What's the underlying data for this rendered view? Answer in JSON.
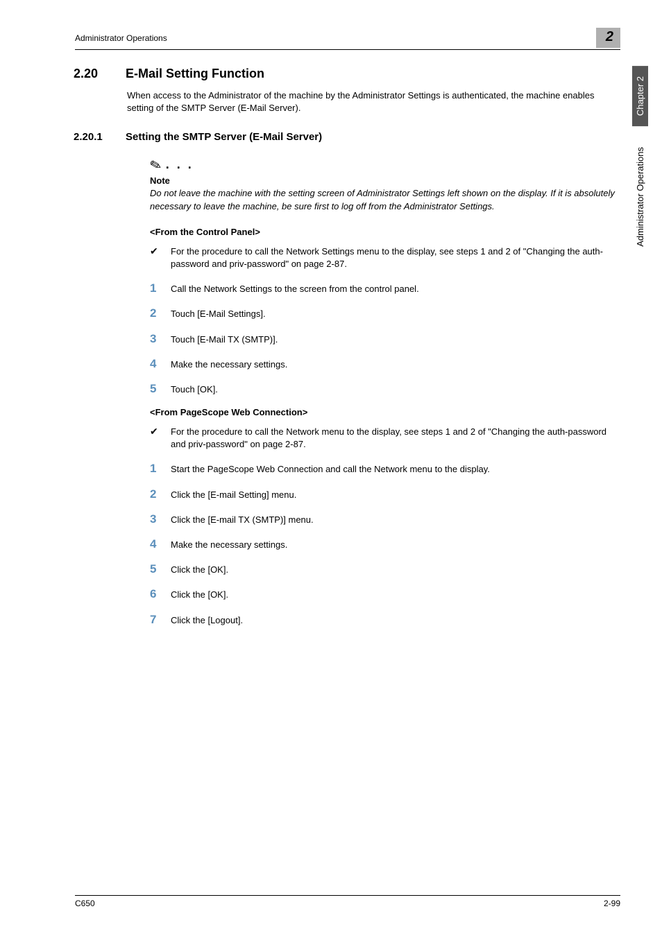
{
  "header": {
    "left": "Administrator Operations",
    "badge": "2"
  },
  "section": {
    "num": "2.20",
    "title": "E-Mail Setting Function",
    "intro": "When access to the Administrator of the machine by the Administrator Settings is authenticated, the machine enables setting of the SMTP Server (E-Mail Server)."
  },
  "subsection": {
    "num": "2.20.1",
    "title": "Setting the SMTP Server (E-Mail Server)"
  },
  "note": {
    "label": "Note",
    "text": "Do not leave the machine with the setting screen of Administrator Settings left shown on the display. If it is absolutely necessary to leave the machine, be sure first to log off from the Administrator Settings."
  },
  "panel1": {
    "heading": "<From the Control Panel>",
    "prereq": "For the procedure to call the Network Settings menu to the display, see steps 1 and 2 of \"Changing the auth-password and priv-password\" on page 2-87.",
    "steps": [
      "Call the Network Settings to the screen from the control panel.",
      "Touch [E-Mail Settings].",
      "Touch [E-Mail TX (SMTP)].",
      "Make the necessary settings.",
      "Touch [OK]."
    ]
  },
  "panel2": {
    "heading": "<From PageScope Web Connection>",
    "prereq": "For the procedure to call the Network menu to the display, see steps 1 and 2 of \"Changing the auth-password and priv-password\" on page 2-87.",
    "steps": [
      "Start the PageScope Web Connection and call the Network menu to the display.",
      "Click the [E-mail Setting] menu.",
      "Click the [E-mail TX (SMTP)] menu.",
      "Make the necessary settings.",
      "Click the [OK].",
      "Click the [OK].",
      "Click the [Logout]."
    ]
  },
  "stepNumbers": [
    "1",
    "2",
    "3",
    "4",
    "5",
    "6",
    "7"
  ],
  "sidetab": {
    "dark": "Chapter 2",
    "light": "Administrator Operations"
  },
  "footer": {
    "left": "C650",
    "right": "2-99"
  }
}
